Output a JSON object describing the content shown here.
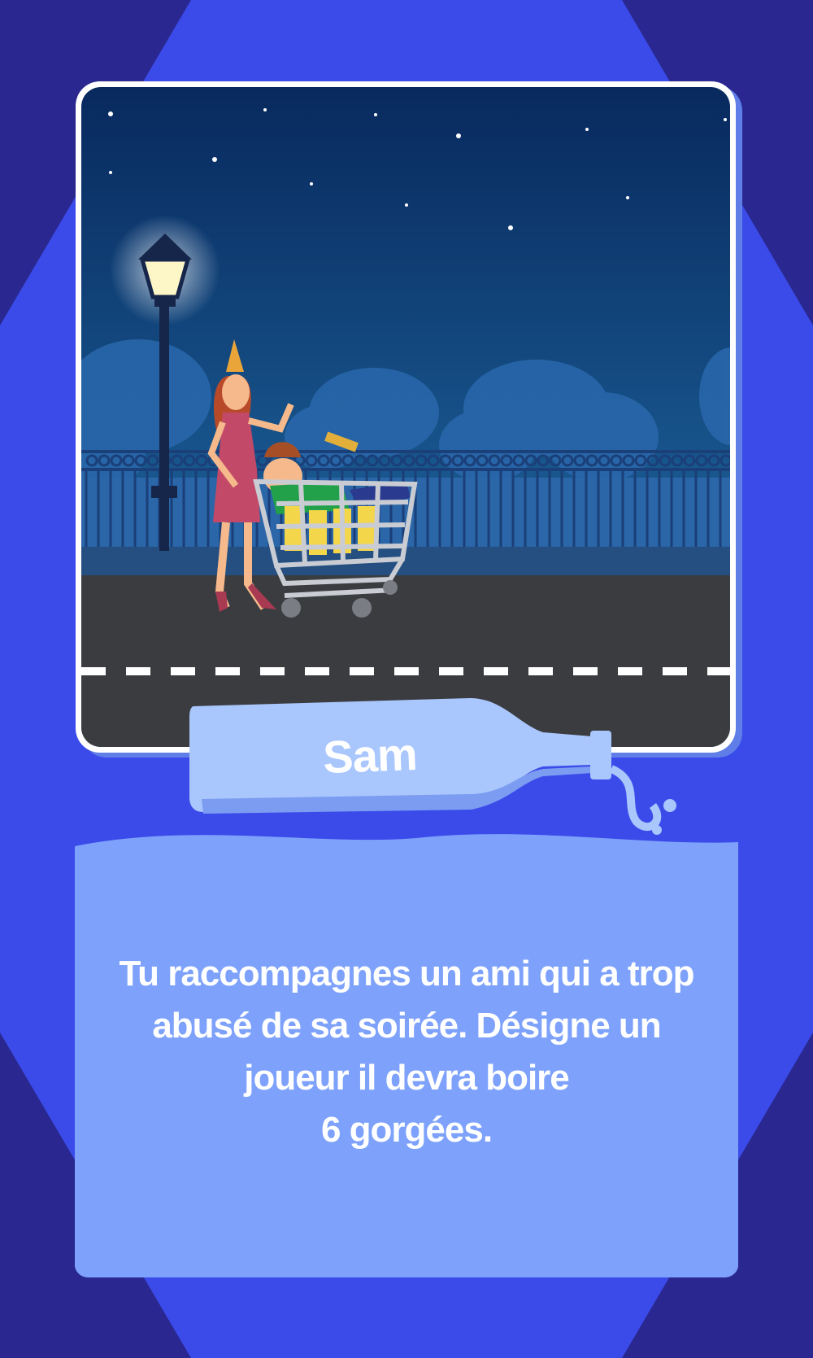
{
  "card": {
    "player_name": "Sam",
    "prompt_lines": [
      "Tu raccompagnes un ami qui a trop",
      "abusé de sa soirée. Désigne un",
      "joueur il devra boire",
      "6 gorgées."
    ]
  },
  "colors": {
    "background_dark": "#2a2890",
    "background_mid": "#3a4ce8",
    "panel": "#7ea2fb",
    "bottle": "#a9c6fd",
    "sky_top": "#0a2a5e",
    "road": "#3b3c40"
  },
  "illustration": {
    "icons": [
      "street-lamp-icon",
      "shopping-cart-icon",
      "party-hat-icon",
      "beer-bottle-icon",
      "star-icon"
    ]
  }
}
